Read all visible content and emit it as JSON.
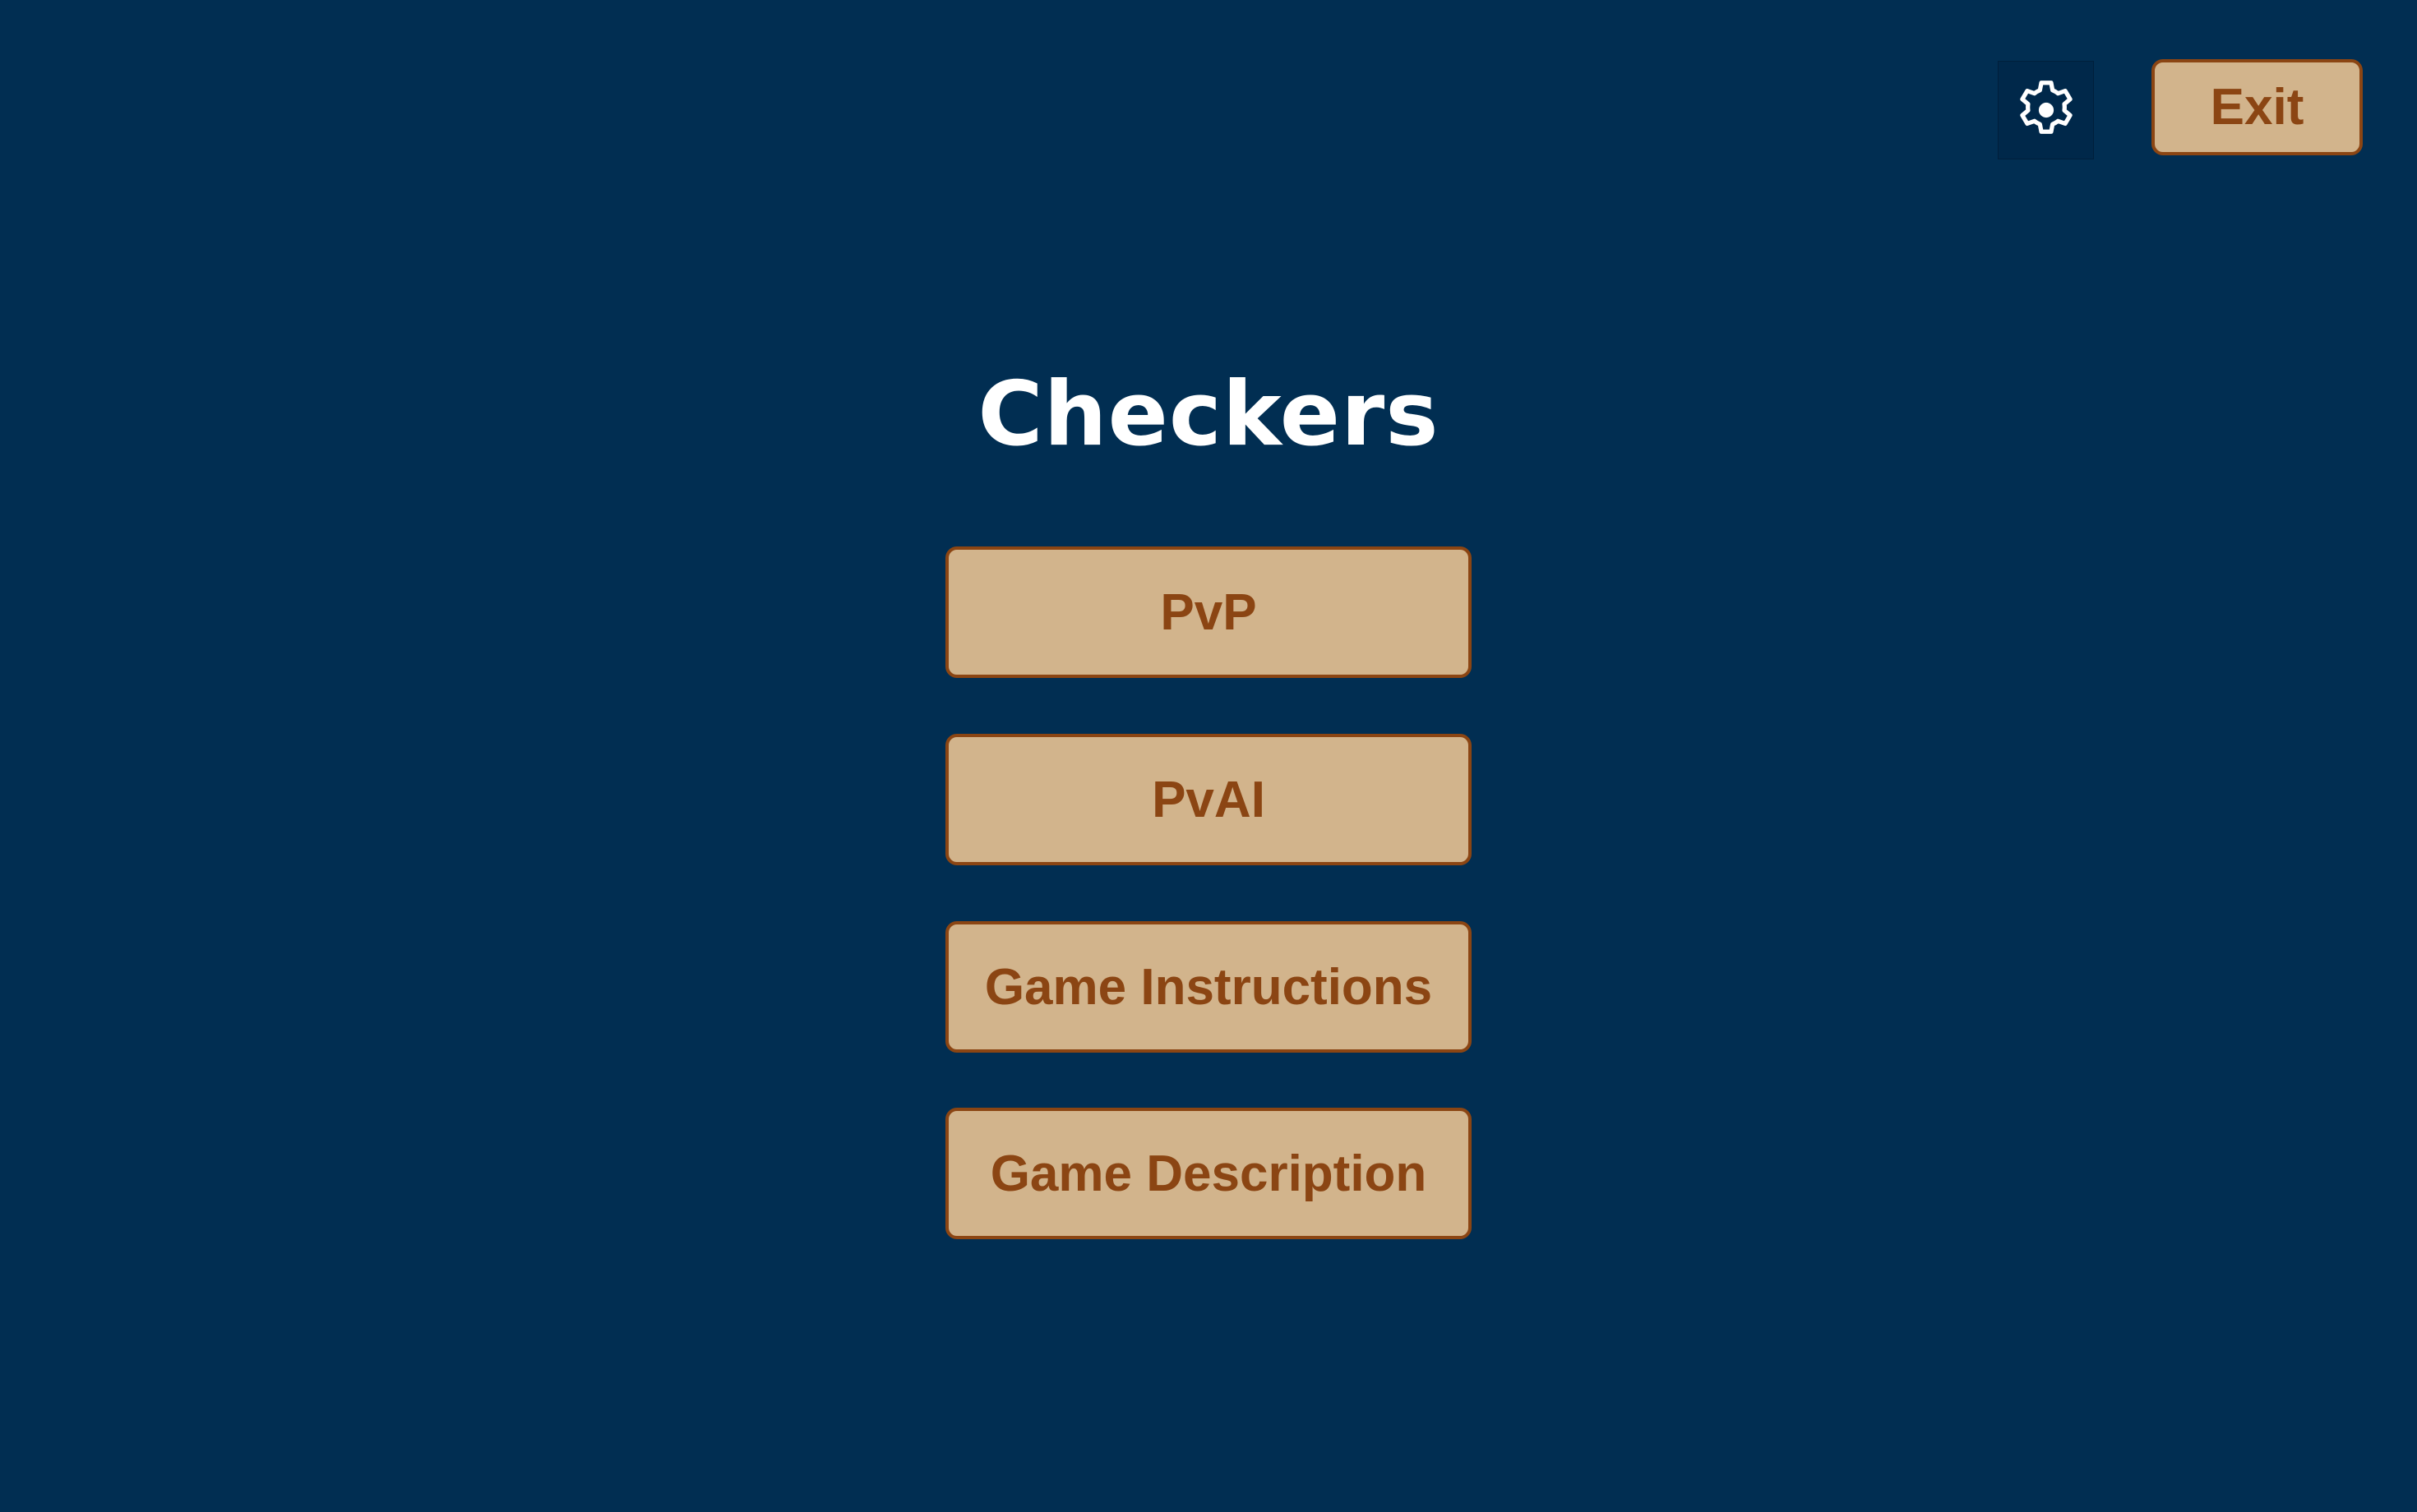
{
  "header": {
    "settings_icon": "gear-icon",
    "exit_label": "Exit"
  },
  "title": "Checkers",
  "menu": {
    "items": [
      {
        "label": "PvP"
      },
      {
        "label": "PvAI"
      },
      {
        "label": "Game Instructions"
      },
      {
        "label": "Game Description"
      }
    ]
  },
  "colors": {
    "background": "#012e52",
    "button_fill": "#d2b48c",
    "button_border": "#8b4513",
    "button_text": "#8b4513",
    "title_text": "#ffffff",
    "settings_button_bg": "#00284a"
  }
}
